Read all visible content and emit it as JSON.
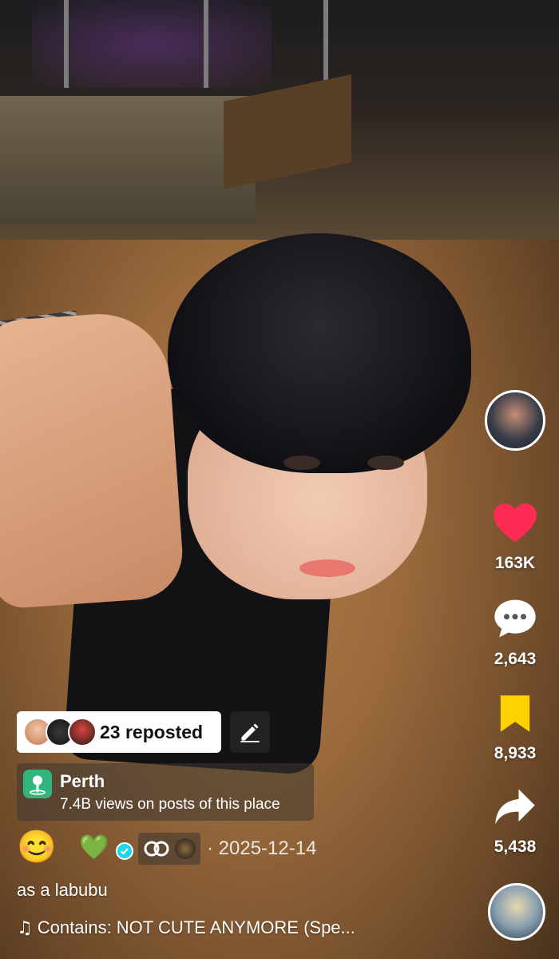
{
  "video": {
    "caption": "as a labubu",
    "music_label": "Contains: NOT CUTE ANYMORE (Spe...",
    "date": "· 2025-12-14",
    "author_emojis": "😊",
    "author_heart": "💚"
  },
  "repost": {
    "label": "23 reposted"
  },
  "location": {
    "name": "Perth",
    "subtitle": "7.4B views on posts of this place"
  },
  "actions": {
    "likes": "163K",
    "comments": "2,643",
    "saves": "8,933",
    "shares": "5,438"
  },
  "colors": {
    "like": "#fe2c55",
    "save": "#fdd200",
    "location_pin": "#2eb67d",
    "verified": "#20d5ec"
  },
  "icons": {
    "like": "heart-icon",
    "comment": "comment-icon",
    "save": "bookmark-icon",
    "share": "share-icon",
    "music": "music-note-icon",
    "edit": "pencil-icon",
    "location": "location-pin-icon"
  }
}
